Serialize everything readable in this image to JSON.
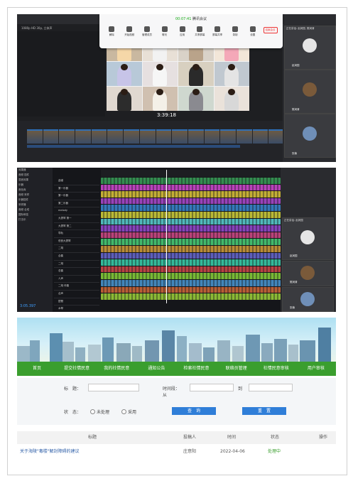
{
  "meeting": {
    "timer": "00:07:41",
    "title": "腾讯会议",
    "tools": [
      "解除",
      "开始视频",
      "管理成员",
      "聊天",
      "应用",
      "共享屏幕",
      "屏幕共享",
      "录制",
      "设置",
      "结束会议"
    ],
    "end_label": "结束会议",
    "participants": [
      {
        "name": "赵润国"
      },
      {
        "name": "樊润清"
      },
      {
        "name": "张楠"
      }
    ],
    "panel_title": "正在讲话: 赵润国, 樊润清"
  },
  "editor": {
    "video_label": "1080p HD 30p, 立体声",
    "timecode": "3:39:18",
    "clip_label": "校园 · 00:00:06"
  },
  "daw": {
    "time_counter": "3:05.397",
    "browser_items": [
      "效果器",
      "音频 插件",
      "混音效果",
      "乐器",
      "音色库",
      "音频 采样",
      "乐器插件",
      "采样器",
      "音频 合成",
      "国际和弦",
      "打击乐"
    ],
    "track_names": [
      "曲谱",
      "第一乐器",
      "第一乐器",
      "第二乐器",
      "melody",
      "大提琴 第一",
      "大提琴 第二",
      "导轨",
      "低音大提琴",
      "二胡",
      "合奏",
      "二胡",
      "总奏",
      "人声",
      "二胡 伴奏",
      "合声",
      "琵琶",
      "木琴",
      "主奏"
    ],
    "side_participants": [
      {
        "name": "赵润国"
      },
      {
        "name": "樊润清"
      },
      {
        "name": "张楠"
      }
    ],
    "side_title": "正在讲话: 赵润国"
  },
  "portal": {
    "nav": [
      "首页",
      "提交社情民意",
      "我的社情民意",
      "通知公告",
      "检索社情民意",
      "联络员管理",
      "社情民意审核",
      "用户审核"
    ],
    "form": {
      "title_label": "标　题：",
      "period_label": "时间段：从",
      "to_label": "到",
      "status_label": "状　态：",
      "status_options": [
        "未处理",
        "采用"
      ],
      "search_button": "查　询",
      "reset_button": "重　置"
    },
    "table": {
      "headers": [
        "标题",
        "投稿人",
        "时间",
        "状态",
        "操作"
      ],
      "rows": [
        {
          "title": "关于海陵\"毒楼\"解封障碍的建议",
          "author": "庄意阳",
          "date": "2022-04-06",
          "status": "处理中",
          "action": ""
        }
      ]
    },
    "colors": {
      "nav": "#3a9e2e",
      "button": "#2f7ed8",
      "status_processing": "#3a9e2e"
    }
  }
}
